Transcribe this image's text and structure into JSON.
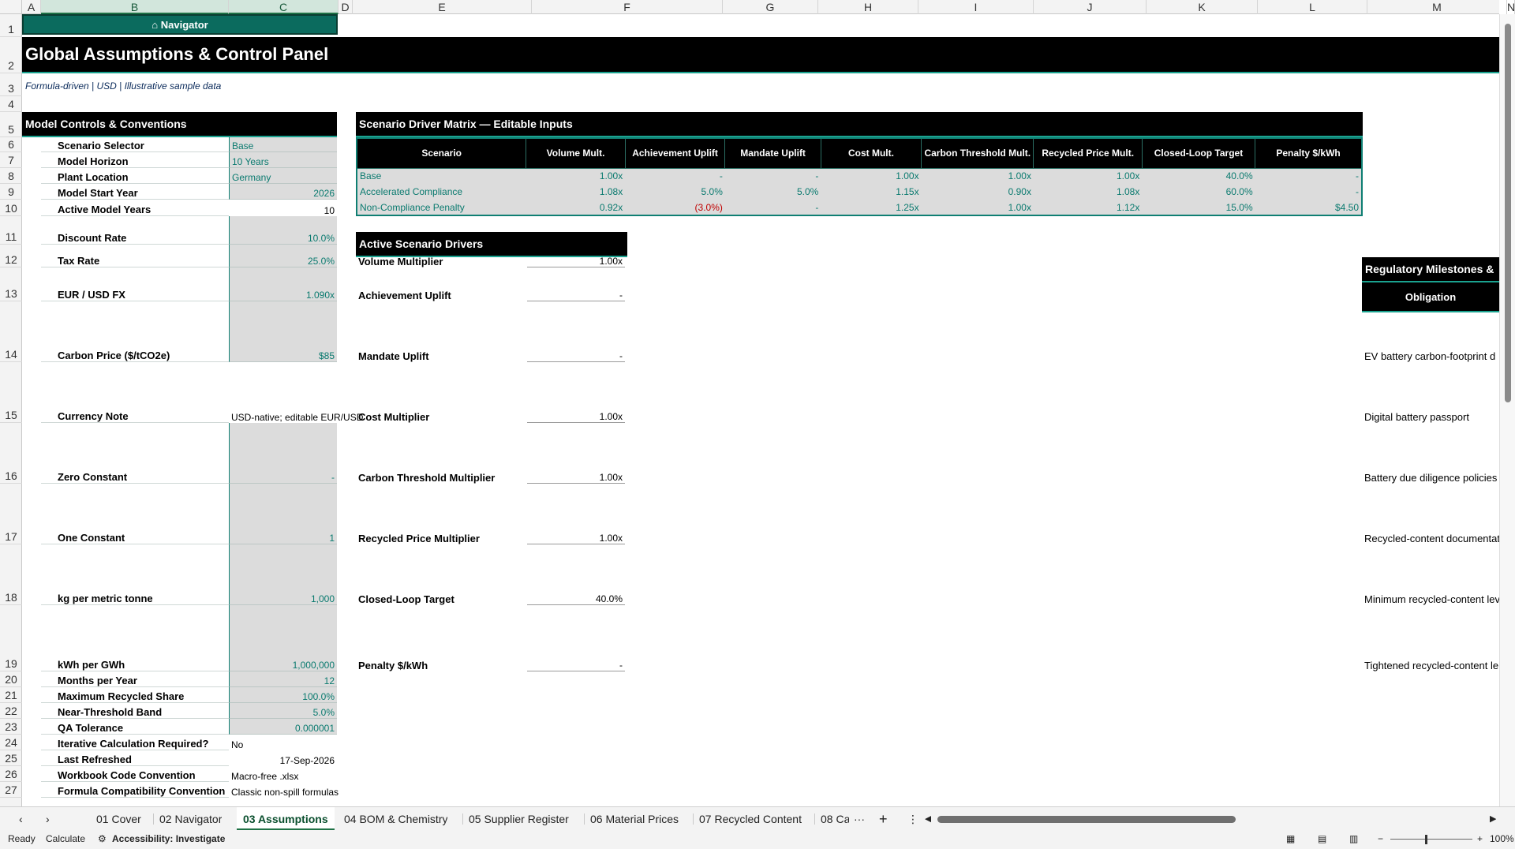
{
  "columns": [
    "A",
    "B",
    "C",
    "D",
    "E",
    "F",
    "G",
    "H",
    "I",
    "J",
    "K",
    "L",
    "M",
    "N"
  ],
  "selected_columns": [
    "B",
    "C"
  ],
  "rows": [
    "1",
    "2",
    "3",
    "4",
    "5",
    "6",
    "7",
    "8",
    "9",
    "10",
    "11",
    "12",
    "13",
    "14",
    "15",
    "16",
    "17",
    "18",
    "19",
    "20",
    "21",
    "22",
    "23",
    "24",
    "25",
    "26",
    "27"
  ],
  "navigator_button": "⌂ Navigator",
  "title": "Global Assumptions & Control Panel",
  "subtitle": "Formula-driven | USD | Illustrative sample data",
  "controls": {
    "header": "Model Controls & Conventions",
    "items": [
      {
        "label": "Scenario Selector",
        "value": "Base",
        "kind": "inp"
      },
      {
        "label": "Model Horizon",
        "value": "10 Years",
        "kind": "inp"
      },
      {
        "label": "Plant Location",
        "value": "Germany",
        "kind": "inp"
      },
      {
        "label": "Model Start Year",
        "value": "2026",
        "kind": "inp-r"
      },
      {
        "label": "Active Model Years",
        "value": "10",
        "kind": "val-r"
      },
      {
        "label": "Discount Rate",
        "value": "10.0%",
        "kind": "inp-r"
      },
      {
        "label": "Tax Rate",
        "value": "25.0%",
        "kind": "inp-r"
      },
      {
        "label": "EUR / USD FX",
        "value": "1.090x",
        "kind": "inp-r"
      },
      {
        "label": "Carbon Price ($/tCO2e)",
        "value": "$85",
        "kind": "inp-r"
      },
      {
        "label": "Currency Note",
        "value": "USD-native; editable EUR/USD",
        "kind": "val"
      },
      {
        "label": "Zero Constant",
        "value": "-",
        "kind": "inp-r"
      },
      {
        "label": "One Constant",
        "value": "1",
        "kind": "inp-r"
      },
      {
        "label": "kg per metric tonne",
        "value": "1,000",
        "kind": "inp-r"
      },
      {
        "label": "kWh per GWh",
        "value": "1,000,000",
        "kind": "inp-r"
      },
      {
        "label": "Months per Year",
        "value": "12",
        "kind": "inp-r"
      },
      {
        "label": "Maximum Recycled Share",
        "value": "100.0%",
        "kind": "inp-r"
      },
      {
        "label": "Near-Threshold Band",
        "value": "5.0%",
        "kind": "inp-r"
      },
      {
        "label": "QA Tolerance",
        "value": "0.000001",
        "kind": "inp-r"
      },
      {
        "label": "Iterative Calculation Required?",
        "value": "No",
        "kind": "val"
      },
      {
        "label": "Last Refreshed",
        "value": "17-Sep-2026",
        "kind": "val-r"
      },
      {
        "label": "Workbook Code Convention",
        "value": "Macro-free .xlsx",
        "kind": "val"
      },
      {
        "label": "Formula Compatibility Convention",
        "value": "Classic non-spill formulas",
        "kind": "val"
      }
    ]
  },
  "matrix": {
    "header": "Scenario Driver Matrix — Editable Inputs",
    "columns": [
      "Scenario",
      "Volume Mult.",
      "Achievement Uplift",
      "Mandate Uplift",
      "Cost Mult.",
      "Carbon Threshold Mult.",
      "Recycled Price Mult.",
      "Closed-Loop Target",
      "Penalty $/kWh"
    ],
    "rows": [
      [
        "Base",
        "1.00x",
        "-",
        "-",
        "1.00x",
        "1.00x",
        "1.00x",
        "40.0%",
        "-"
      ],
      [
        "Accelerated Compliance",
        "1.08x",
        "5.0%",
        "5.0%",
        "1.15x",
        "0.90x",
        "1.08x",
        "60.0%",
        "-"
      ],
      [
        "Non-Compliance Penalty",
        "0.92x",
        "(3.0%)",
        "-",
        "1.25x",
        "1.00x",
        "1.12x",
        "15.0%",
        "$4.50"
      ]
    ]
  },
  "drivers": {
    "header": "Active Scenario Drivers",
    "items": [
      {
        "label": "Volume Multiplier",
        "value": "1.00x"
      },
      {
        "label": "Achievement Uplift",
        "value": "-"
      },
      {
        "label": "Mandate Uplift",
        "value": "-"
      },
      {
        "label": "Cost Multiplier",
        "value": "1.00x"
      },
      {
        "label": "Carbon Threshold Multiplier",
        "value": "1.00x"
      },
      {
        "label": "Recycled Price Multiplier",
        "value": "1.00x"
      },
      {
        "label": "Closed-Loop Target",
        "value": "40.0%"
      },
      {
        "label": "Penalty $/kWh",
        "value": "-"
      }
    ]
  },
  "regulatory": {
    "header": "Regulatory Milestones &",
    "col_header": "Obligation",
    "items": [
      "EV battery carbon-footprint d",
      "Digital battery passport",
      "Battery due diligence policies",
      "Recycled-content documentat",
      "Minimum recycled-content lev",
      "Tightened recycled-content le"
    ]
  },
  "sheet_tabs": [
    "01 Cover",
    "02 Navigator",
    "03 Assumptions",
    "04 BOM & Chemistry",
    "05 Supplier Register",
    "06 Material Prices",
    "07 Recycled Content",
    "08 Ca"
  ],
  "active_tab": "03 Assumptions",
  "tab_more": "···",
  "tab_add": "+",
  "tab_menu": "⋮",
  "status": {
    "ready": "Ready",
    "calculate": "Calculate",
    "accessibility": "Accessibility: Investigate",
    "zoom": "100%"
  }
}
